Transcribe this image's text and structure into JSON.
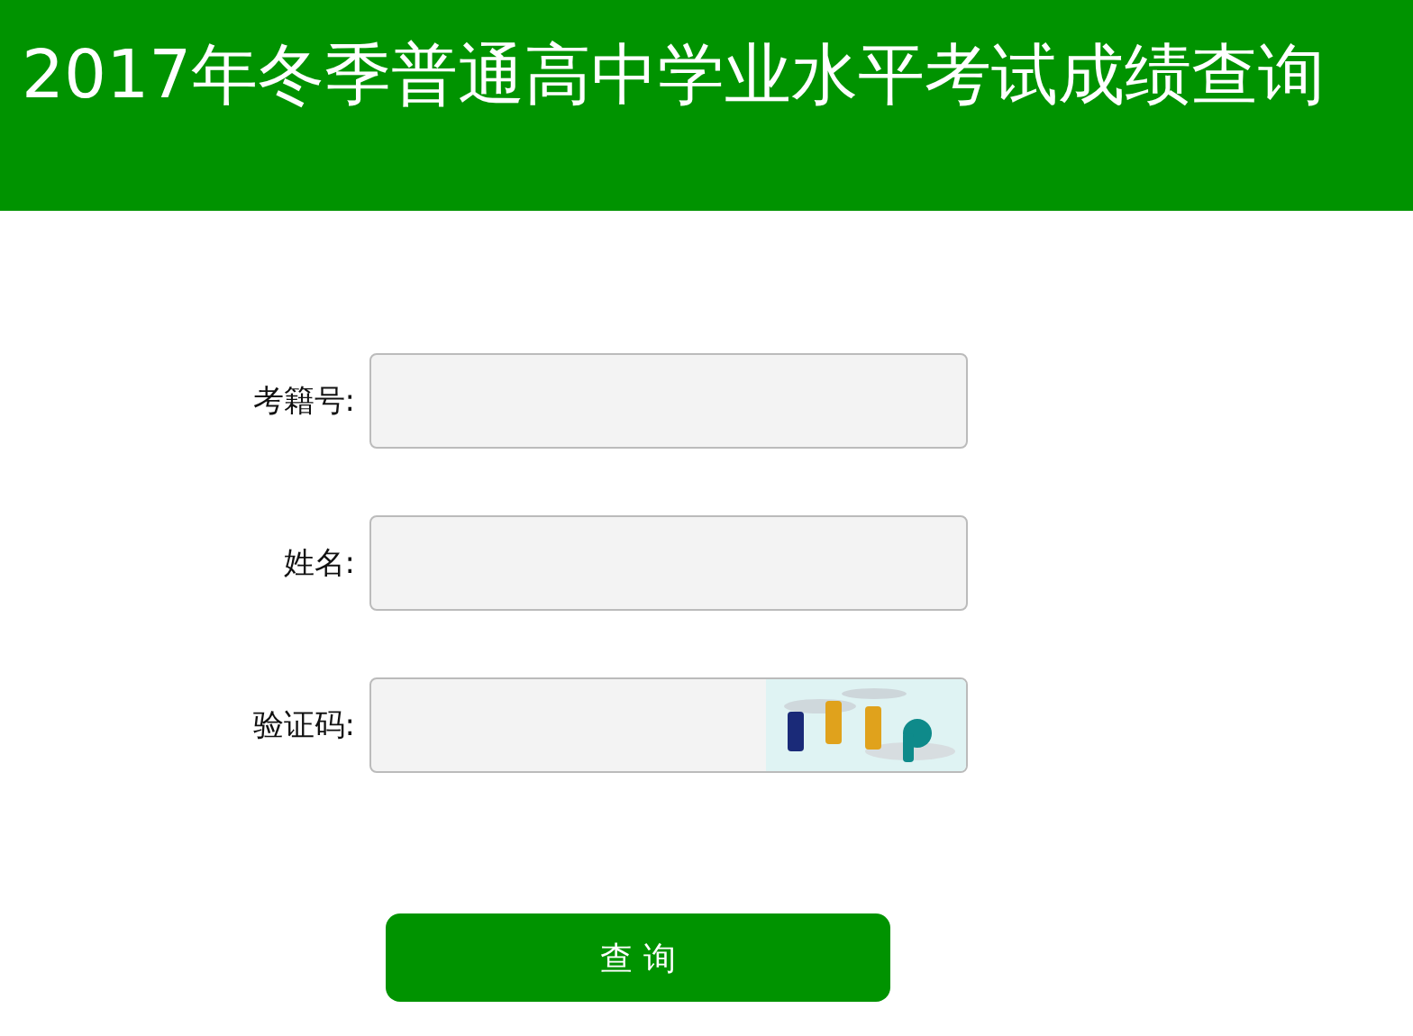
{
  "header": {
    "title": "2017年冬季普通高中学业水平考试成绩查询"
  },
  "fields": [
    {
      "label": "考籍号:",
      "kind": "text"
    },
    {
      "label": "姓名:",
      "kind": "text"
    },
    {
      "label": "验证码:",
      "kind": "captcha"
    }
  ],
  "submit_button": {
    "label": "查 询"
  }
}
